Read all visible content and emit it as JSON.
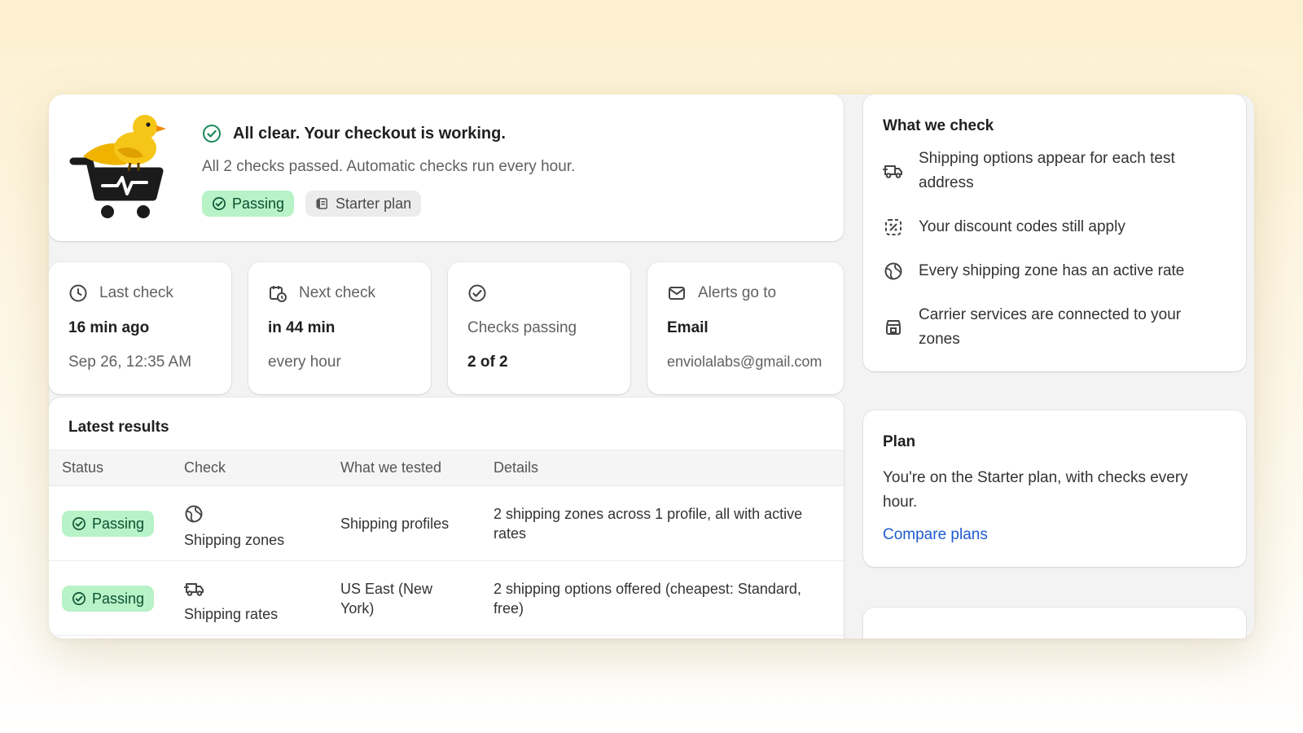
{
  "hero": {
    "headline": "All clear. Your checkout is working.",
    "subtext": "All 2 checks passed. Automatic checks run every hour.",
    "status_badge": "Passing",
    "plan_badge": "Starter plan"
  },
  "stats": [
    {
      "label": "Last check",
      "value": "16 min ago",
      "sub": "Sep 26, 12:35 AM",
      "icon": "clock-icon"
    },
    {
      "label": "Next check",
      "value": "in 44 min",
      "sub": "every hour",
      "icon": "calendar-clock-icon"
    },
    {
      "label": "",
      "value": "Checks passing",
      "sub": "2 of 2",
      "icon": "check-circle-icon"
    },
    {
      "label": "Alerts go to",
      "value": "Email",
      "sub": "enviolalabs@gmail.com",
      "icon": "email-icon"
    }
  ],
  "results": {
    "title": "Latest results",
    "columns": [
      "Status",
      "Check",
      "What we tested",
      "Details"
    ],
    "rows": [
      {
        "status": "Passing",
        "check": "Shipping zones",
        "check_icon": "globe-icon",
        "tested": "Shipping profiles",
        "details": "2 shipping zones across 1 profile, all with active rates"
      },
      {
        "status": "Passing",
        "check": "Shipping rates",
        "check_icon": "truck-icon",
        "tested": "US East (New York)",
        "details": "2 shipping options offered (cheapest: Standard, free)"
      }
    ]
  },
  "what_we_check": {
    "title": "What we check",
    "items": [
      {
        "text": "Shipping options appear for each test address",
        "icon": "truck-icon"
      },
      {
        "text": "Your discount codes still apply",
        "icon": "discount-icon"
      },
      {
        "text": "Every shipping zone has an active rate",
        "icon": "globe-icon"
      },
      {
        "text": "Carrier services are connected to your zones",
        "icon": "store-icon"
      }
    ]
  },
  "plan": {
    "title": "Plan",
    "text": "You're on the Starter plan, with checks every hour.",
    "link": "Compare plans"
  },
  "colors": {
    "passing_bg": "#b8f2c7",
    "passing_text": "#0c5132",
    "link": "#1f5bd1",
    "mascot_bird": "#f5c518"
  }
}
